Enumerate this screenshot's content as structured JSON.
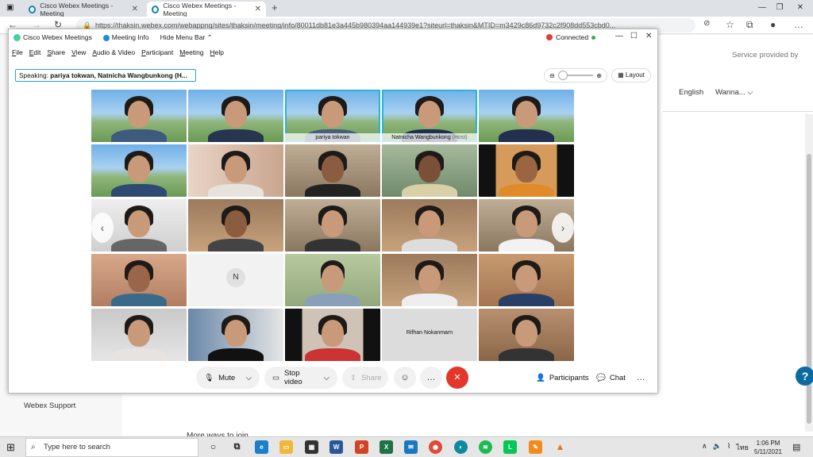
{
  "browser": {
    "tabs": [
      {
        "title": "Cisco Webex Meetings - Meeting",
        "close": "✕"
      },
      {
        "title": "Cisco Webex Meetings - Meeting",
        "close": "✕"
      }
    ],
    "new_tab": "+",
    "url": "https://thaksin.webex.com/webappng/sites/thaksin/meeting/info/80011db81e3a445b980394aa144939e1?siteurl=thaksin&MTID=m3429c86d9732c2f908dd553cbd0..."
  },
  "page": {
    "provided_by": "Service provided by",
    "language": "English",
    "user": "Wanna...",
    "support": "Webex Support",
    "more_ways": "More ways to join"
  },
  "webex": {
    "app_title": "Cisco Webex Meetings",
    "meeting_info": "Meeting Info",
    "hide_menu": "Hide Menu Bar",
    "status": "Connected",
    "menu": [
      "File",
      "Edit",
      "Share",
      "View",
      "Audio & Video",
      "Participant",
      "Meeting",
      "Help"
    ],
    "speaking_label": "Speaking:",
    "speaking_names": "pariya tokwan, Natnicha Wangbunkong (H...",
    "layout": "Layout",
    "tiles": [
      {
        "label": ""
      },
      {
        "label": ""
      },
      {
        "label": "pariya tokwan"
      },
      {
        "label": "Natnicha Wangbunkong",
        "host": "(Host)"
      },
      {
        "label": ""
      },
      {
        "label": ""
      },
      {
        "label": ""
      },
      {
        "label": ""
      },
      {
        "label": ""
      },
      {
        "label": ""
      },
      {
        "label": ""
      },
      {
        "label": ""
      },
      {
        "label": ""
      },
      {
        "label": ""
      },
      {
        "label": ""
      },
      {
        "label": ""
      },
      {
        "label": ""
      },
      {
        "label": ""
      },
      {
        "label": ""
      },
      {
        "label": ""
      },
      {
        "label": ""
      },
      {
        "label": ""
      },
      {
        "label": ""
      },
      {
        "label": ""
      },
      {
        "label": ""
      }
    ],
    "avatar_initial": "N",
    "name_only": "Rifhan Nokanmarn",
    "controls": {
      "mute": "Mute",
      "stop_video": "Stop video",
      "share": "Share",
      "participants": "Participants",
      "chat": "Chat"
    }
  },
  "taskbar": {
    "search_placeholder": "Type here to search",
    "lang": "ไทย",
    "time": "1:06 PM",
    "date": "5/11/2021"
  }
}
